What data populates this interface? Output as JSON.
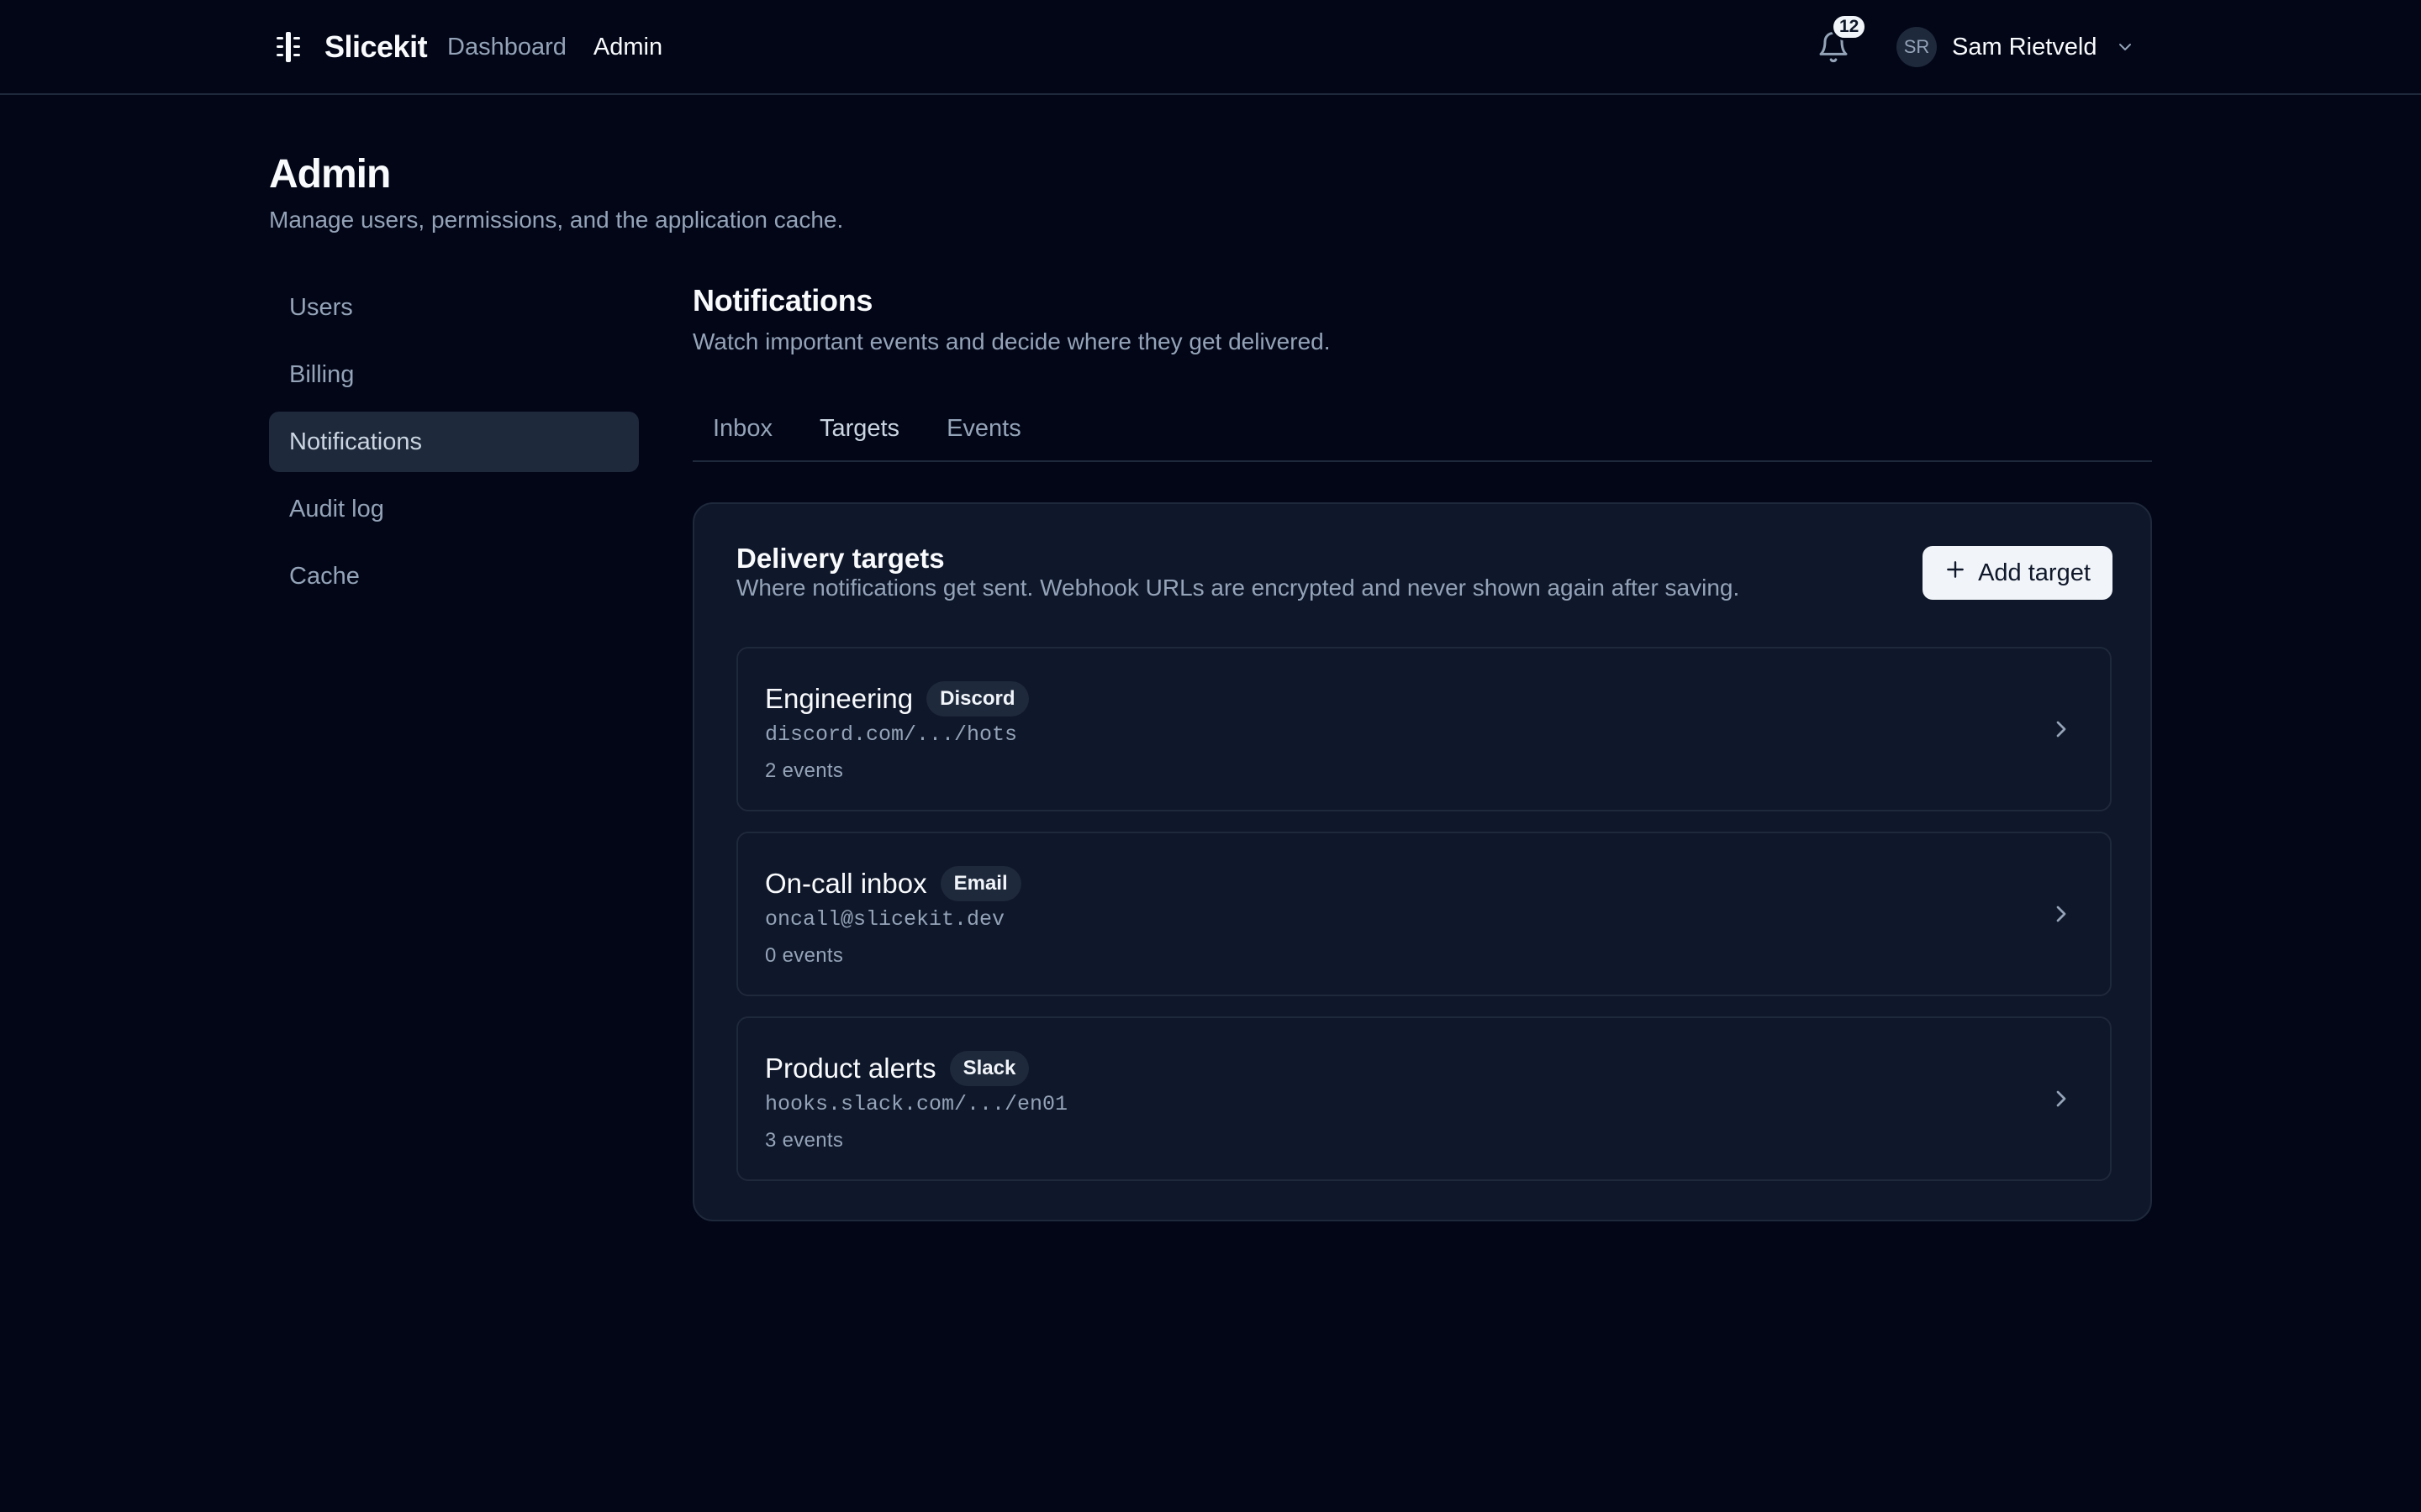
{
  "app": {
    "brand_name": "Slicekit",
    "brand_icon": "slicekit-logo-icon",
    "nav": [
      {
        "label": "Dashboard",
        "active": false
      },
      {
        "label": "Admin",
        "active": true
      }
    ],
    "notifications": {
      "icon": "bell-icon",
      "count": "12"
    },
    "user": {
      "initials": "SR",
      "name": "Sam Rietveld",
      "menu_icon": "chevron-down-icon"
    }
  },
  "page": {
    "title": "Admin",
    "subtitle": "Manage users, permissions, and the application cache."
  },
  "sidebar": {
    "items": [
      {
        "label": "Users",
        "active": false
      },
      {
        "label": "Billing",
        "active": false
      },
      {
        "label": "Notifications",
        "active": true
      },
      {
        "label": "Audit log",
        "active": false
      },
      {
        "label": "Cache",
        "active": false
      }
    ]
  },
  "section": {
    "title": "Notifications",
    "subtitle": "Watch important events and decide where they get delivered."
  },
  "tabs": [
    {
      "label": "Inbox",
      "active": false
    },
    {
      "label": "Targets",
      "active": true
    },
    {
      "label": "Events",
      "active": false
    }
  ],
  "card": {
    "title": "Delivery targets",
    "description": "Where notifications get sent. Webhook URLs are encrypted and never shown again after saving.",
    "add_button": {
      "label": "Add target",
      "icon": "plus-icon"
    }
  },
  "targets": [
    {
      "name": "Engineering",
      "type": "Discord",
      "url": "discord.com/.../hots",
      "events": "2 events"
    },
    {
      "name": "On-call inbox",
      "type": "Email",
      "url": "oncall@slicekit.dev",
      "events": "0 events"
    },
    {
      "name": "Product alerts",
      "type": "Slack",
      "url": "hooks.slack.com/.../en01",
      "events": "3 events"
    }
  ],
  "colors": {
    "background": "#020617",
    "surface": "#0f172a",
    "border": "#1e293b",
    "text": "#f8fafc",
    "muted": "#94a3b8",
    "button": "#f1f5f9"
  }
}
